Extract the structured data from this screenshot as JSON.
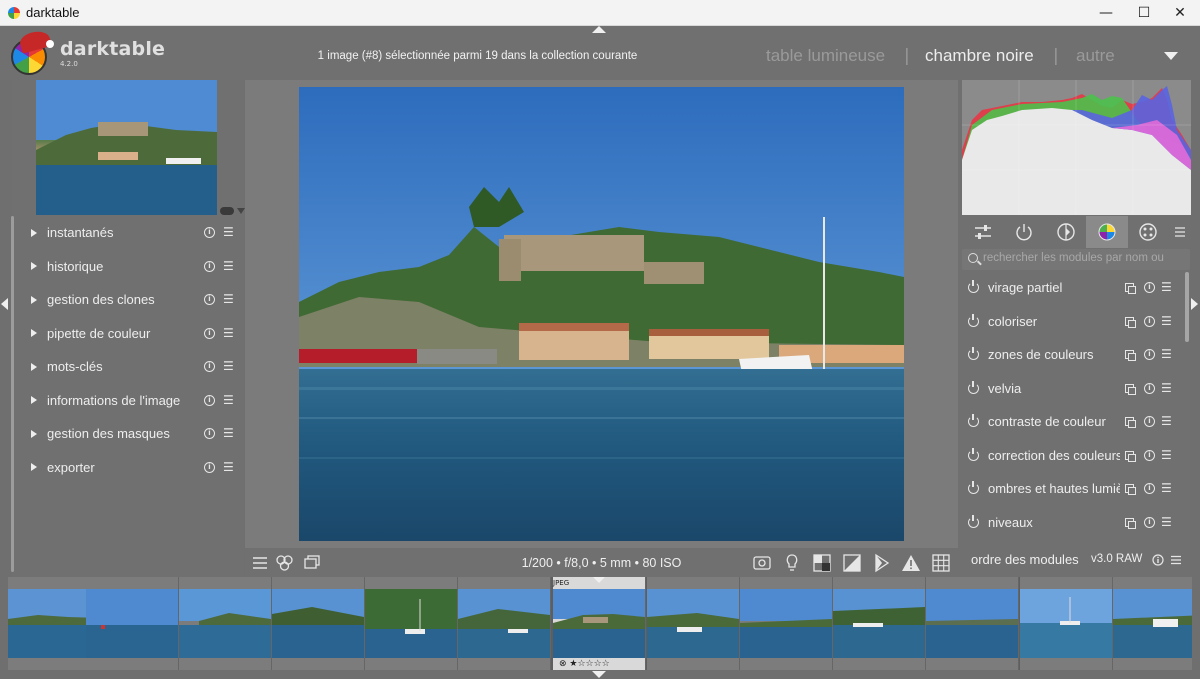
{
  "window": {
    "title": "darktable",
    "min_glyph": "—",
    "max_glyph": "☐",
    "close_glyph": "✕"
  },
  "header": {
    "brand": "darktable",
    "version": "4.2.0",
    "collection_info": "1 image (#8) sélectionnée parmi 19 dans la collection courante",
    "views": {
      "lighttable": "table lumineuse",
      "darkroom": "chambre noire",
      "other": "autre",
      "separator": "|"
    }
  },
  "left_modules": [
    {
      "label": "instantanés"
    },
    {
      "label": "historique"
    },
    {
      "label": "gestion des clones"
    },
    {
      "label": "pipette de couleur"
    },
    {
      "label": "mots-clés"
    },
    {
      "label": "informations de l'image"
    },
    {
      "label": "gestion des masques"
    },
    {
      "label": "exporter"
    }
  ],
  "center": {
    "exif": "1/200 • f/8,0 • 5 mm • 80 ISO"
  },
  "right": {
    "search_placeholder": "rechercher les modules par nom ou",
    "modules": [
      {
        "label": "virage partiel"
      },
      {
        "label": "coloriser"
      },
      {
        "label": "zones de couleurs"
      },
      {
        "label": "velvia"
      },
      {
        "label": "contraste de couleur"
      },
      {
        "label": "correction des couleurs"
      },
      {
        "label": "ombres et hautes lumières"
      },
      {
        "label": "niveaux"
      }
    ],
    "order_label": "ordre des modules",
    "order_value": "v3.0 RAW"
  },
  "filmstrip": {
    "selected_badge": "JPEG",
    "selected_rating": "⊗ ★☆☆☆☆",
    "count": 13
  },
  "colors": {
    "panel": "#707070",
    "text": "#eeeeee",
    "accent": "#ededed"
  }
}
